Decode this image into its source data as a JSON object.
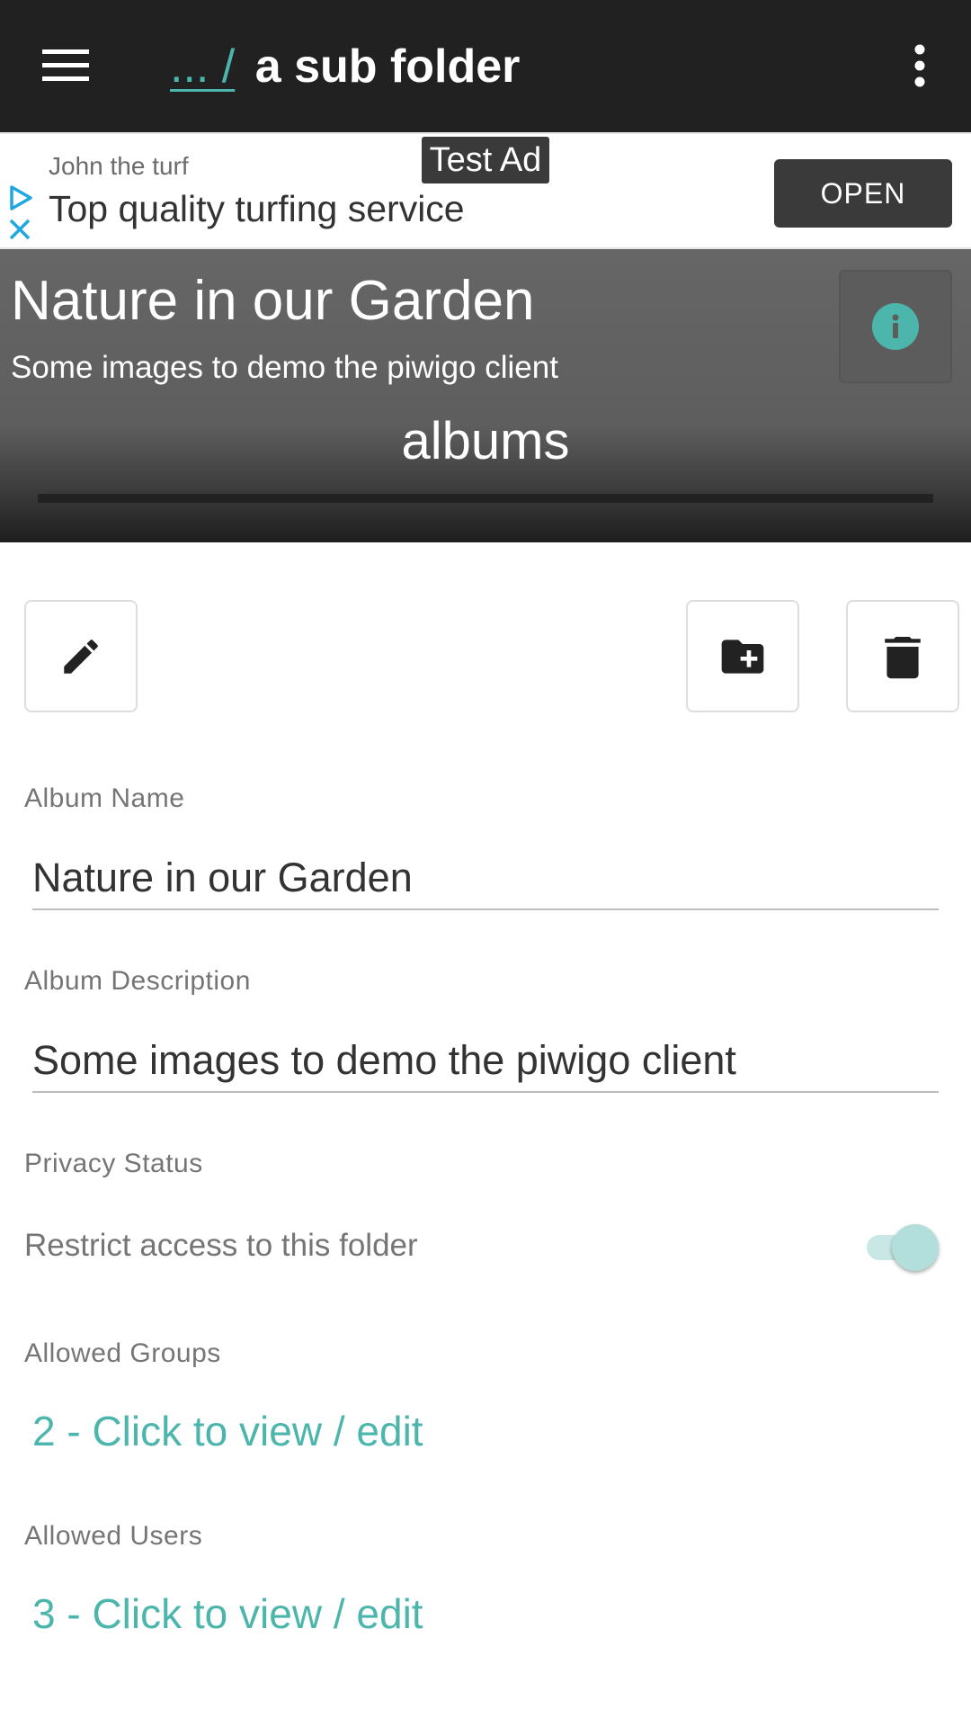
{
  "appbar": {
    "breadcrumb_link": "... /",
    "current_folder": "a sub folder",
    "menu_icon": "hamburger-menu-icon",
    "overflow_icon": "more-vert-icon"
  },
  "ad": {
    "badge": "Test Ad",
    "advertiser": "John the turf",
    "headline": "Top quality turfing service",
    "cta": "OPEN",
    "icons": [
      "adchoices-icon",
      "close-icon"
    ]
  },
  "album": {
    "title": "Nature in our Garden",
    "description": "Some images to demo the piwigo client",
    "section_label": "albums",
    "info_icon": "info-icon"
  },
  "actions": {
    "edit_icon": "pencil-icon",
    "add_folder_icon": "create-folder-icon",
    "delete_icon": "trash-icon"
  },
  "form": {
    "name_label": "Album Name",
    "name_value": "Nature in our Garden",
    "description_label": "Album Description",
    "description_value": "Some images to demo the piwigo client",
    "privacy_label": "Privacy Status",
    "restrict_label": "Restrict access to this folder",
    "restrict_enabled": true,
    "groups_label": "Allowed Groups",
    "groups_value": "2 - Click to view / edit",
    "users_label": "Allowed Users",
    "users_value": "3 - Click to view / edit"
  },
  "colors": {
    "appbar": "#212121",
    "accent": "#4db6ac",
    "header_bg": "#666666"
  }
}
